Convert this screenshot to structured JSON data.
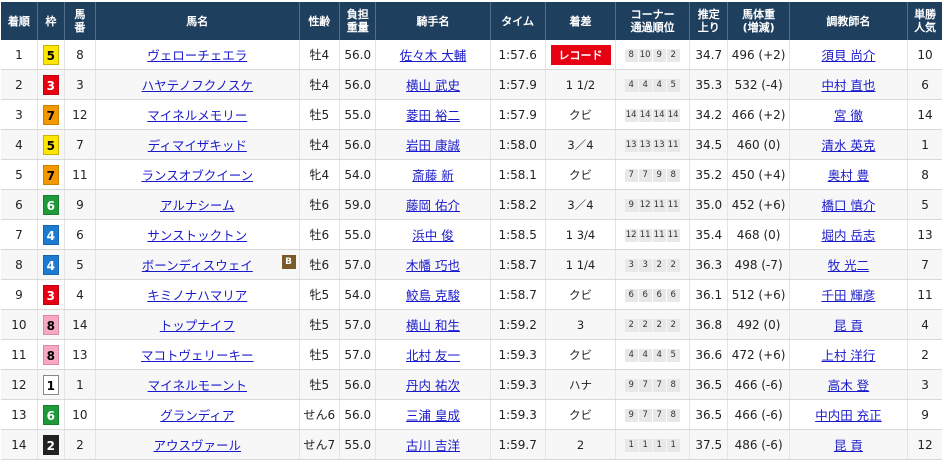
{
  "headers": [
    "着順",
    "枠",
    "馬番",
    "馬名",
    "性齢",
    "負担重量",
    "騎手名",
    "タイム",
    "着差",
    "コーナー通過順位",
    "推定上り",
    "馬体重(増減)",
    "調教師名",
    "単勝人気"
  ],
  "header_lines": {
    "umaban": [
      "馬",
      "番"
    ],
    "futan": [
      "負担",
      "重量"
    ],
    "corner": [
      "コーナー",
      "通過順位"
    ],
    "agari": [
      "推定",
      "上り"
    ],
    "bataiju": [
      "馬体重",
      "(増減)"
    ],
    "ninki": [
      "単勝",
      "人気"
    ]
  },
  "record_label": "レコード",
  "rows": [
    {
      "rank": "1",
      "waku": 5,
      "umaban": "8",
      "horse": "ヴェローチェエラ",
      "blinker": "",
      "sex": "牡4",
      "weight": "56.0",
      "jockey": "佐々木 大輔",
      "time": "1:57.6",
      "margin": "",
      "record": true,
      "corners": [
        "8",
        "10",
        "9",
        "2"
      ],
      "last3f": "34.7",
      "bodyweight": "496 (+2)",
      "trainer": "須貝 尚介",
      "pop": "10"
    },
    {
      "rank": "2",
      "waku": 3,
      "umaban": "3",
      "horse": "ハヤテノフクノスケ",
      "blinker": "",
      "sex": "牡4",
      "weight": "56.0",
      "jockey": "横山 武史",
      "time": "1:57.9",
      "margin": "1 1/2",
      "record": false,
      "corners": [
        "4",
        "4",
        "4",
        "5"
      ],
      "last3f": "35.3",
      "bodyweight": "532 (-4)",
      "trainer": "中村 直也",
      "pop": "6"
    },
    {
      "rank": "3",
      "waku": 7,
      "umaban": "12",
      "horse": "マイネルメモリー",
      "blinker": "",
      "sex": "牡5",
      "weight": "55.0",
      "jockey": "菱田 裕二",
      "time": "1:57.9",
      "margin": "クビ",
      "record": false,
      "corners": [
        "14",
        "14",
        "14",
        "14"
      ],
      "last3f": "34.2",
      "bodyweight": "466 (+2)",
      "trainer": "宮 徹",
      "pop": "14"
    },
    {
      "rank": "4",
      "waku": 5,
      "umaban": "7",
      "horse": "ディマイザキッド",
      "blinker": "",
      "sex": "牡4",
      "weight": "56.0",
      "jockey": "岩田 康誠",
      "time": "1:58.0",
      "margin": "3／4",
      "record": false,
      "corners": [
        "13",
        "13",
        "13",
        "11"
      ],
      "last3f": "34.5",
      "bodyweight": "460 (0)",
      "trainer": "清水 英克",
      "pop": "1"
    },
    {
      "rank": "5",
      "waku": 7,
      "umaban": "11",
      "horse": "ランスオブクイーン",
      "blinker": "",
      "sex": "牝4",
      "weight": "54.0",
      "jockey": "斎藤 新",
      "time": "1:58.1",
      "margin": "クビ",
      "record": false,
      "corners": [
        "7",
        "7",
        "9",
        "8"
      ],
      "last3f": "35.2",
      "bodyweight": "450 (+4)",
      "trainer": "奥村 豊",
      "pop": "8"
    },
    {
      "rank": "6",
      "waku": 6,
      "umaban": "9",
      "horse": "アルナシーム",
      "blinker": "",
      "sex": "牡6",
      "weight": "59.0",
      "jockey": "藤岡 佑介",
      "time": "1:58.2",
      "margin": "3／4",
      "record": false,
      "corners": [
        "9",
        "12",
        "11",
        "11"
      ],
      "last3f": "35.0",
      "bodyweight": "452 (+6)",
      "trainer": "橋口 慎介",
      "pop": "5"
    },
    {
      "rank": "7",
      "waku": 4,
      "umaban": "6",
      "horse": "サンストックトン",
      "blinker": "",
      "sex": "牡6",
      "weight": "55.0",
      "jockey": "浜中 俊",
      "time": "1:58.5",
      "margin": "1 3/4",
      "record": false,
      "corners": [
        "12",
        "11",
        "11",
        "11"
      ],
      "last3f": "35.4",
      "bodyweight": "468 (0)",
      "trainer": "堀内 岳志",
      "pop": "13"
    },
    {
      "rank": "8",
      "waku": 4,
      "umaban": "5",
      "horse": "ボーンディスウェイ",
      "blinker": "B",
      "sex": "牡6",
      "weight": "57.0",
      "jockey": "木幡 巧也",
      "time": "1:58.7",
      "margin": "1 1/4",
      "record": false,
      "corners": [
        "3",
        "3",
        "2",
        "2"
      ],
      "last3f": "36.3",
      "bodyweight": "498 (-7)",
      "trainer": "牧 光二",
      "pop": "7"
    },
    {
      "rank": "9",
      "waku": 3,
      "umaban": "4",
      "horse": "キミノナハマリア",
      "blinker": "",
      "sex": "牝5",
      "weight": "54.0",
      "jockey": "鮫島 克駿",
      "time": "1:58.7",
      "margin": "クビ",
      "record": false,
      "corners": [
        "6",
        "6",
        "6",
        "6"
      ],
      "last3f": "36.1",
      "bodyweight": "512 (+6)",
      "trainer": "千田 輝彦",
      "pop": "11"
    },
    {
      "rank": "10",
      "waku": 8,
      "umaban": "14",
      "horse": "トップナイフ",
      "blinker": "",
      "sex": "牡5",
      "weight": "57.0",
      "jockey": "横山 和生",
      "time": "1:59.2",
      "margin": "3",
      "record": false,
      "corners": [
        "2",
        "2",
        "2",
        "2"
      ],
      "last3f": "36.8",
      "bodyweight": "492 (0)",
      "trainer": "昆 貢",
      "pop": "4"
    },
    {
      "rank": "11",
      "waku": 8,
      "umaban": "13",
      "horse": "マコトヴェリーキー",
      "blinker": "",
      "sex": "牡5",
      "weight": "57.0",
      "jockey": "北村 友一",
      "time": "1:59.3",
      "margin": "クビ",
      "record": false,
      "corners": [
        "4",
        "4",
        "4",
        "5"
      ],
      "last3f": "36.6",
      "bodyweight": "472 (+6)",
      "trainer": "上村 洋行",
      "pop": "2"
    },
    {
      "rank": "12",
      "waku": 1,
      "umaban": "1",
      "horse": "マイネルモーント",
      "blinker": "",
      "sex": "牡5",
      "weight": "56.0",
      "jockey": "丹内 祐次",
      "time": "1:59.3",
      "margin": "ハナ",
      "record": false,
      "corners": [
        "9",
        "7",
        "7",
        "8"
      ],
      "last3f": "36.5",
      "bodyweight": "466 (-6)",
      "trainer": "高木 登",
      "pop": "3"
    },
    {
      "rank": "13",
      "waku": 6,
      "umaban": "10",
      "horse": "グランディア",
      "blinker": "",
      "sex": "せん6",
      "weight": "56.0",
      "jockey": "三浦 皇成",
      "time": "1:59.3",
      "margin": "クビ",
      "record": false,
      "corners": [
        "9",
        "7",
        "7",
        "8"
      ],
      "last3f": "36.5",
      "bodyweight": "466 (-6)",
      "trainer": "中内田 充正",
      "pop": "9"
    },
    {
      "rank": "14",
      "waku": 2,
      "umaban": "2",
      "horse": "アウスヴァール",
      "blinker": "",
      "sex": "せん7",
      "weight": "55.0",
      "jockey": "古川 吉洋",
      "time": "1:59.7",
      "margin": "2",
      "record": false,
      "corners": [
        "1",
        "1",
        "1",
        "1"
      ],
      "last3f": "37.5",
      "bodyweight": "486 (-6)",
      "trainer": "昆 貢",
      "pop": "12"
    }
  ]
}
